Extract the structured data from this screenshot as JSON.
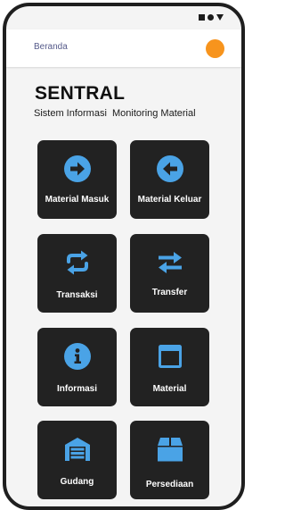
{
  "appbar": {
    "title": "Beranda",
    "avatar_color": "#f7941d"
  },
  "header": {
    "title": "SENTRAL",
    "subtitle": "Sistem Informasi  Monitoring Material"
  },
  "colors": {
    "tile_bg": "#222222",
    "icon_blue": "#4aa3e6"
  },
  "menu": [
    {
      "label": "Material Masuk",
      "icon": "arrow-right-circle-icon"
    },
    {
      "label": "Material Keluar",
      "icon": "arrow-left-circle-icon"
    },
    {
      "label": "Transaksi",
      "icon": "sync-icon"
    },
    {
      "label": "Transfer",
      "icon": "swap-arrows-icon"
    },
    {
      "label": "Informasi",
      "icon": "info-circle-icon"
    },
    {
      "label": "Material",
      "icon": "window-icon"
    },
    {
      "label": "Gudang",
      "icon": "warehouse-icon"
    },
    {
      "label": "Persediaan",
      "icon": "box-icon"
    }
  ]
}
